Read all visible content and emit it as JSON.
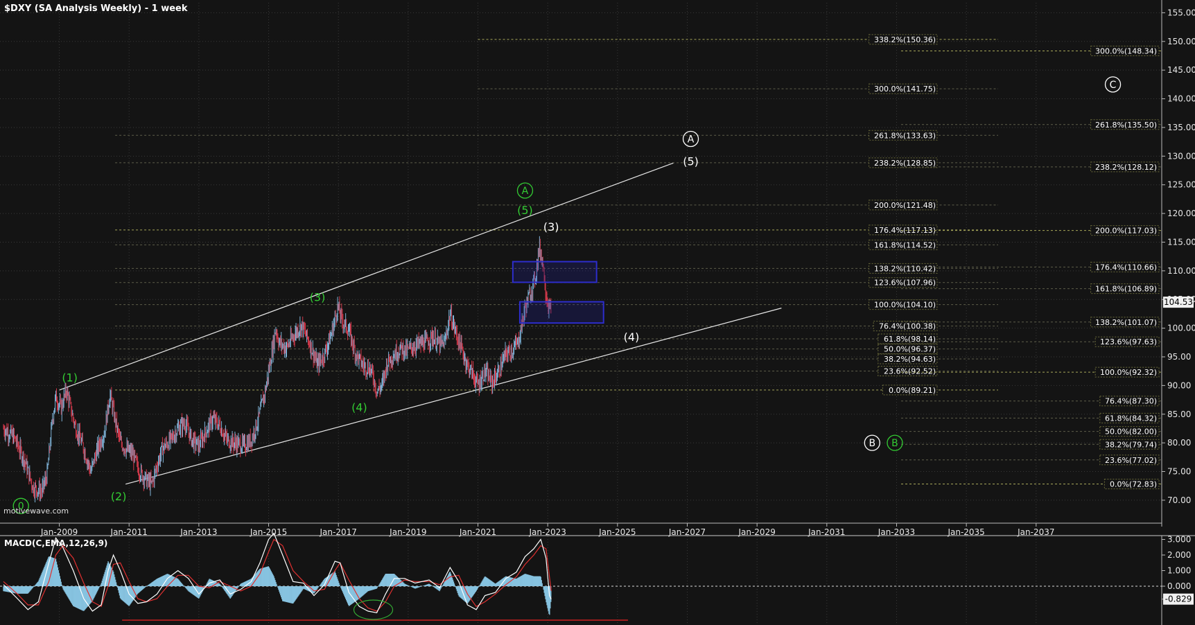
{
  "header": {
    "title": "$DXY (SA Analysis Weekly) - 1 week"
  },
  "watermark": "motivewave.com",
  "colors": {
    "background": "#141414",
    "grid": "#3a3a3a",
    "fib_line": "#a8a85a",
    "candle_up": "#7fb3d8",
    "candle_down": "#d2394b",
    "wave_green": "#33cc33",
    "wave_white": "#ffffff",
    "box": "#2d2dcc",
    "macd_line": "#ffffff",
    "macd_signal": "#e03030",
    "macd_hist": "#87c3e0",
    "support_line": "#cc2020"
  },
  "chart_data": [
    {
      "type": "candlestick",
      "title": "$DXY (SA Analysis Weekly) - 1 week",
      "x_ticks": [
        "Jan-2009",
        "Jan-2011",
        "Jan-2013",
        "Jan-2015",
        "Jan-2017",
        "Jan-2019",
        "Jan-2021",
        "Jan-2023",
        "Jan-2025",
        "Jan-2027",
        "Jan-2029",
        "Jan-2031",
        "Jan-2033",
        "Jan-2035",
        "Jan-2037"
      ],
      "y_ticks": [
        70,
        75,
        80,
        85,
        90,
        95,
        100,
        105,
        110,
        115,
        120,
        125,
        130,
        135,
        140,
        145,
        150,
        155
      ],
      "ylim": [
        66,
        156.5
      ],
      "current_price": "104.53",
      "grid": true,
      "price_path": [
        [
          2007.4,
          82.5
        ],
        [
          2007.7,
          81.0
        ],
        [
          2008.0,
          77.0
        ],
        [
          2008.25,
          72.2
        ],
        [
          2008.5,
          71.5
        ],
        [
          2008.65,
          74.5
        ],
        [
          2008.8,
          84.0
        ],
        [
          2008.9,
          88.0
        ],
        [
          2009.05,
          86.0
        ],
        [
          2009.2,
          89.2
        ],
        [
          2009.45,
          83.0
        ],
        [
          2009.7,
          79.0
        ],
        [
          2009.9,
          75.0
        ],
        [
          2010.1,
          79.0
        ],
        [
          2010.3,
          82.0
        ],
        [
          2010.45,
          88.5
        ],
        [
          2010.6,
          84.0
        ],
        [
          2010.75,
          80.0
        ],
        [
          2010.9,
          79.0
        ],
        [
          2011.1,
          78.0
        ],
        [
          2011.3,
          75.0
        ],
        [
          2011.5,
          73.5
        ],
        [
          2011.65,
          72.8
        ],
        [
          2011.8,
          76.0
        ],
        [
          2011.95,
          79.0
        ],
        [
          2012.2,
          80.5
        ],
        [
          2012.4,
          82.5
        ],
        [
          2012.6,
          83.5
        ],
        [
          2012.8,
          80.5
        ],
        [
          2013.0,
          79.5
        ],
        [
          2013.2,
          82.0
        ],
        [
          2013.4,
          84.2
        ],
        [
          2013.6,
          83.0
        ],
        [
          2013.8,
          80.5
        ],
        [
          2014.0,
          80.0
        ],
        [
          2014.3,
          79.5
        ],
        [
          2014.5,
          80.5
        ],
        [
          2014.7,
          84.0
        ],
        [
          2014.9,
          89.0
        ],
        [
          2015.1,
          96.0
        ],
        [
          2015.2,
          100.0
        ],
        [
          2015.3,
          97.5
        ],
        [
          2015.5,
          96.5
        ],
        [
          2015.8,
          99.5
        ],
        [
          2015.95,
          100.5
        ],
        [
          2016.2,
          97.0
        ],
        [
          2016.4,
          93.5
        ],
        [
          2016.6,
          95.5
        ],
        [
          2016.8,
          99.0
        ],
        [
          2016.98,
          103.8
        ],
        [
          2017.1,
          101.5
        ],
        [
          2017.3,
          99.5
        ],
        [
          2017.5,
          95.5
        ],
        [
          2017.7,
          93.5
        ],
        [
          2017.9,
          93.0
        ],
        [
          2018.0,
          91.5
        ],
        [
          2018.1,
          89.0
        ],
        [
          2018.25,
          90.0
        ],
        [
          2018.4,
          94.0
        ],
        [
          2018.6,
          95.5
        ],
        [
          2018.8,
          96.5
        ],
        [
          2018.95,
          96.0
        ],
        [
          2019.2,
          97.0
        ],
        [
          2019.5,
          97.5
        ],
        [
          2019.7,
          98.5
        ],
        [
          2019.9,
          97.0
        ],
        [
          2020.05,
          97.5
        ],
        [
          2020.2,
          102.5
        ],
        [
          2020.35,
          99.5
        ],
        [
          2020.55,
          96.0
        ],
        [
          2020.7,
          93.5
        ],
        [
          2020.85,
          92.0
        ],
        [
          2021.0,
          90.0
        ],
        [
          2021.2,
          92.5
        ],
        [
          2021.4,
          90.5
        ],
        [
          2021.6,
          92.5
        ],
        [
          2021.8,
          95.5
        ],
        [
          2021.95,
          96.0
        ],
        [
          2022.15,
          97.5
        ],
        [
          2022.35,
          103.5
        ],
        [
          2022.55,
          107.0
        ],
        [
          2022.65,
          109.0
        ],
        [
          2022.75,
          114.0
        ],
        [
          2022.85,
          112.0
        ],
        [
          2022.95,
          106.0
        ],
        [
          2023.05,
          103.0
        ],
        [
          2023.1,
          104.5
        ]
      ],
      "overlays": {
        "rising_channel": {
          "upper": [
            [
              2009.0,
              89.2
            ],
            [
              2026.6,
              128.8
            ]
          ],
          "lower": [
            [
              2010.9,
              72.8
            ],
            [
              2029.7,
              103.5
            ]
          ]
        },
        "fib_lines_left": [
          "338.2%(150.36)",
          "300.0%(141.75)",
          "261.8%(133.63)",
          "238.2%(128.85)",
          "200.0%(121.48)",
          "176.4%(117.13)",
          "161.8%(114.52)",
          "138.2%(110.42)",
          "123.6%(107.96)",
          "100.0%(104.10)",
          "76.4%(100.38)",
          "61.8%(98.14)",
          "50.0%(96.37)",
          "38.2%(94.63)",
          "23.6%(92.52)",
          "0.0%(89.21)"
        ],
        "fib_lines_right": [
          "300.0%(148.34)",
          "261.8%(135.50)",
          "238.2%(128.12)",
          "200.0%(117.03)",
          "176.4%(110.66)",
          "161.8%(106.89)",
          "138.2%(101.07)",
          "123.6%(97.63)",
          "100.0%(92.32)",
          "76.4%(87.30)",
          "61.8%(84.32)",
          "50.0%(82.00)",
          "38.2%(79.74)",
          "23.6%(77.02)",
          "0.0%(72.83)"
        ],
        "target_boxes": [
          {
            "x0": 2022.0,
            "x1": 2024.4,
            "y0": 108.0,
            "y1": 111.6
          },
          {
            "x0": 2022.2,
            "x1": 2024.6,
            "y0": 100.9,
            "y1": 104.6
          }
        ],
        "wave_labels": [
          {
            "text": "0",
            "x": 2007.9,
            "y": 69.0,
            "color": "green",
            "circled": true
          },
          {
            "text": "(1)",
            "x": 2009.3,
            "y": 91.3,
            "color": "green"
          },
          {
            "text": "(2)",
            "x": 2010.7,
            "y": 70.6,
            "color": "green"
          },
          {
            "text": "(3)",
            "x": 2016.4,
            "y": 105.3,
            "color": "green"
          },
          {
            "text": "(4)",
            "x": 2017.6,
            "y": 86.1,
            "color": "green"
          },
          {
            "text": "A",
            "x": 2022.35,
            "y": 124.0,
            "color": "green",
            "circled": true
          },
          {
            "text": "(5)",
            "x": 2022.35,
            "y": 120.5,
            "color": "green"
          },
          {
            "text": "(3)",
            "x": 2023.1,
            "y": 117.6,
            "color": "white"
          },
          {
            "text": "(4)",
            "x": 2025.4,
            "y": 98.4,
            "color": "white"
          },
          {
            "text": "A",
            "x": 2027.1,
            "y": 133.0,
            "color": "white",
            "circled": true
          },
          {
            "text": "(5)",
            "x": 2027.1,
            "y": 129.0,
            "color": "white"
          },
          {
            "text": "B",
            "x": 2032.3,
            "y": 80.0,
            "color": "white",
            "circled": true
          },
          {
            "text": "B",
            "x": 2032.95,
            "y": 80.0,
            "color": "green",
            "circled": true
          },
          {
            "text": "C",
            "x": 2039.2,
            "y": 142.5,
            "color": "white",
            "circled": true
          }
        ]
      }
    },
    {
      "type": "line",
      "title": "MACD(C,EMA,12,26,9)",
      "y_ticks": [
        "3.000",
        "2.000",
        "1.000",
        "0.000",
        "-0.829"
      ],
      "ylim": [
        -2.0,
        3.5
      ],
      "current_value": "-0.829",
      "series": [
        {
          "values": [
            [
              2007.4,
              0.1
            ],
            [
              2007.8,
              -0.8
            ],
            [
              2008.1,
              -1.5
            ],
            [
              2008.4,
              -1.0
            ],
            [
              2008.7,
              1.5
            ],
            [
              2008.9,
              3.1
            ],
            [
              2009.1,
              2.5
            ],
            [
              2009.4,
              1.0
            ],
            [
              2009.7,
              -0.8
            ],
            [
              2009.95,
              -1.6
            ],
            [
              2010.2,
              -1.2
            ],
            [
              2010.4,
              1.0
            ],
            [
              2010.55,
              2.0
            ],
            [
              2010.75,
              1.0
            ],
            [
              2011.0,
              -0.5
            ],
            [
              2011.25,
              -1.1
            ],
            [
              2011.5,
              -1.0
            ],
            [
              2011.8,
              -0.5
            ],
            [
              2012.1,
              0.5
            ],
            [
              2012.4,
              1.0
            ],
            [
              2012.7,
              0.5
            ],
            [
              2013.0,
              -0.5
            ],
            [
              2013.3,
              0.2
            ],
            [
              2013.6,
              0.4
            ],
            [
              2013.9,
              -0.5
            ],
            [
              2014.2,
              -0.2
            ],
            [
              2014.5,
              0.3
            ],
            [
              2014.75,
              1.5
            ],
            [
              2015.0,
              3.0
            ],
            [
              2015.15,
              3.4
            ],
            [
              2015.4,
              2.0
            ],
            [
              2015.7,
              0.3
            ],
            [
              2016.0,
              0.2
            ],
            [
              2016.3,
              -0.6
            ],
            [
              2016.6,
              0.1
            ],
            [
              2016.9,
              1.6
            ],
            [
              2017.05,
              1.5
            ],
            [
              2017.3,
              -0.4
            ],
            [
              2017.6,
              -1.3
            ],
            [
              2017.85,
              -1.6
            ],
            [
              2018.1,
              -1.7
            ],
            [
              2018.35,
              -0.5
            ],
            [
              2018.6,
              0.5
            ],
            [
              2018.9,
              0.5
            ],
            [
              2019.2,
              0.2
            ],
            [
              2019.6,
              0.4
            ],
            [
              2019.9,
              -0.1
            ],
            [
              2020.2,
              1.2
            ],
            [
              2020.45,
              0.3
            ],
            [
              2020.7,
              -1.2
            ],
            [
              2020.95,
              -1.5
            ],
            [
              2021.2,
              -0.6
            ],
            [
              2021.5,
              -0.4
            ],
            [
              2021.8,
              0.5
            ],
            [
              2022.1,
              0.9
            ],
            [
              2022.35,
              1.9
            ],
            [
              2022.6,
              2.4
            ],
            [
              2022.8,
              3.0
            ],
            [
              2022.95,
              1.8
            ],
            [
              2023.05,
              -0.6
            ],
            [
              2023.1,
              -0.829
            ]
          ]
        },
        {
          "values": [
            [
              2007.4,
              0.3
            ],
            [
              2007.8,
              -0.5
            ],
            [
              2008.1,
              -1.2
            ],
            [
              2008.4,
              -1.2
            ],
            [
              2008.7,
              0.3
            ],
            [
              2008.9,
              2.0
            ],
            [
              2009.1,
              2.6
            ],
            [
              2009.4,
              1.8
            ],
            [
              2009.7,
              0.2
            ],
            [
              2009.95,
              -1.0
            ],
            [
              2010.2,
              -1.3
            ],
            [
              2010.4,
              0.0
            ],
            [
              2010.55,
              1.4
            ],
            [
              2010.75,
              1.5
            ],
            [
              2011.0,
              0.3
            ],
            [
              2011.25,
              -0.8
            ],
            [
              2011.5,
              -1.0
            ],
            [
              2011.8,
              -0.8
            ],
            [
              2012.1,
              0.0
            ],
            [
              2012.4,
              0.7
            ],
            [
              2012.7,
              0.7
            ],
            [
              2013.0,
              0.0
            ],
            [
              2013.3,
              -0.1
            ],
            [
              2013.6,
              0.3
            ],
            [
              2013.9,
              0.0
            ],
            [
              2014.2,
              -0.3
            ],
            [
              2014.5,
              0.0
            ],
            [
              2014.75,
              0.8
            ],
            [
              2015.0,
              2.2
            ],
            [
              2015.15,
              3.0
            ],
            [
              2015.4,
              2.6
            ],
            [
              2015.7,
              1.0
            ],
            [
              2016.0,
              0.3
            ],
            [
              2016.3,
              -0.3
            ],
            [
              2016.6,
              -0.2
            ],
            [
              2016.9,
              1.0
            ],
            [
              2017.05,
              1.5
            ],
            [
              2017.3,
              0.4
            ],
            [
              2017.6,
              -0.8
            ],
            [
              2017.85,
              -1.4
            ],
            [
              2018.1,
              -1.6
            ],
            [
              2018.35,
              -1.0
            ],
            [
              2018.6,
              0.0
            ],
            [
              2018.9,
              0.4
            ],
            [
              2019.2,
              0.3
            ],
            [
              2019.6,
              0.3
            ],
            [
              2019.9,
              0.1
            ],
            [
              2020.2,
              0.6
            ],
            [
              2020.45,
              0.7
            ],
            [
              2020.7,
              -0.5
            ],
            [
              2020.95,
              -1.3
            ],
            [
              2021.2,
              -1.0
            ],
            [
              2021.5,
              -0.5
            ],
            [
              2021.8,
              0.1
            ],
            [
              2022.1,
              0.6
            ],
            [
              2022.35,
              1.4
            ],
            [
              2022.6,
              2.0
            ],
            [
              2022.8,
              2.6
            ],
            [
              2022.95,
              2.4
            ],
            [
              2023.05,
              0.6
            ],
            [
              2023.1,
              -0.3
            ]
          ]
        }
      ]
    }
  ]
}
